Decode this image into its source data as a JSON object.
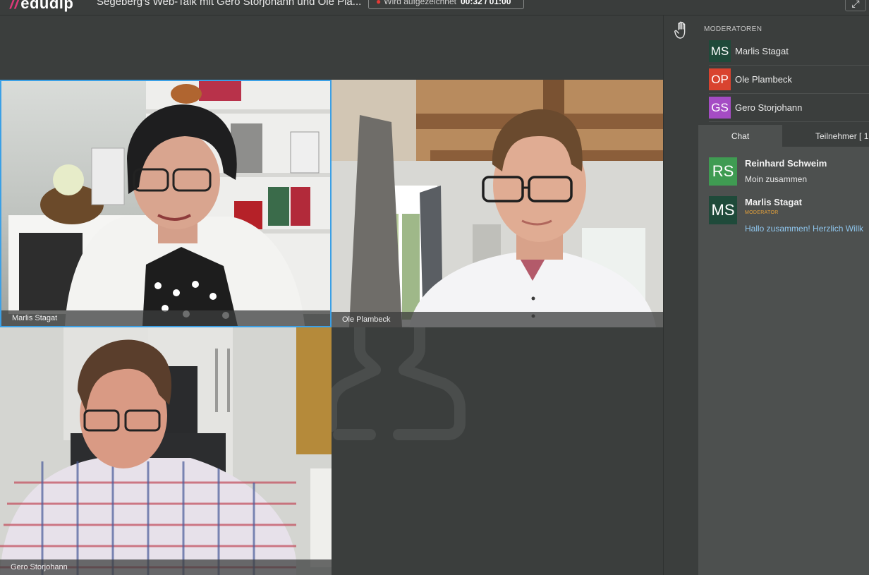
{
  "header": {
    "logo": "edudip",
    "meeting_title": "Segeberg's Web-Talk mit Gero Storjohann und Ole Pla...",
    "recording_label": "Wird aufgezeichnet",
    "recording_time": "00:32 / 01:00"
  },
  "videos": [
    {
      "name": "Marlis Stagat",
      "active": true
    },
    {
      "name": "Ole Plambeck",
      "active": false
    },
    {
      "name": "Gero Storjohann",
      "active": false
    }
  ],
  "sidebar": {
    "moderators_heading": "MODERATOREN",
    "moderators": [
      {
        "initials": "MS",
        "name": "Marlis Stagat",
        "color": "#1f4a3a"
      },
      {
        "initials": "OP",
        "name": "Ole Plambeck",
        "color": "#d9432f"
      },
      {
        "initials": "GS",
        "name": "Gero Storjohann",
        "color": "#a54cc4"
      }
    ],
    "tabs": {
      "chat": "Chat",
      "participants": "Teilnehmer [ 1"
    },
    "messages": [
      {
        "initials": "RS",
        "author": "Reinhard Schweim",
        "role": "",
        "text": "Moin zusammen",
        "avatar_color": "#3f9b52",
        "text_color": "#e8e8e8"
      },
      {
        "initials": "MS",
        "author": "Marlis Stagat",
        "role": "MODERATOR",
        "text": "Hallo zusammen! Herzlich Willk",
        "avatar_color": "#1f4a3a",
        "text_color": "#8fc6ee"
      }
    ]
  },
  "colors": {
    "background": "#3b3e3d",
    "chat_panel": "#4d504f",
    "active_border": "#3ba0e6",
    "brand": "#e0397a"
  }
}
